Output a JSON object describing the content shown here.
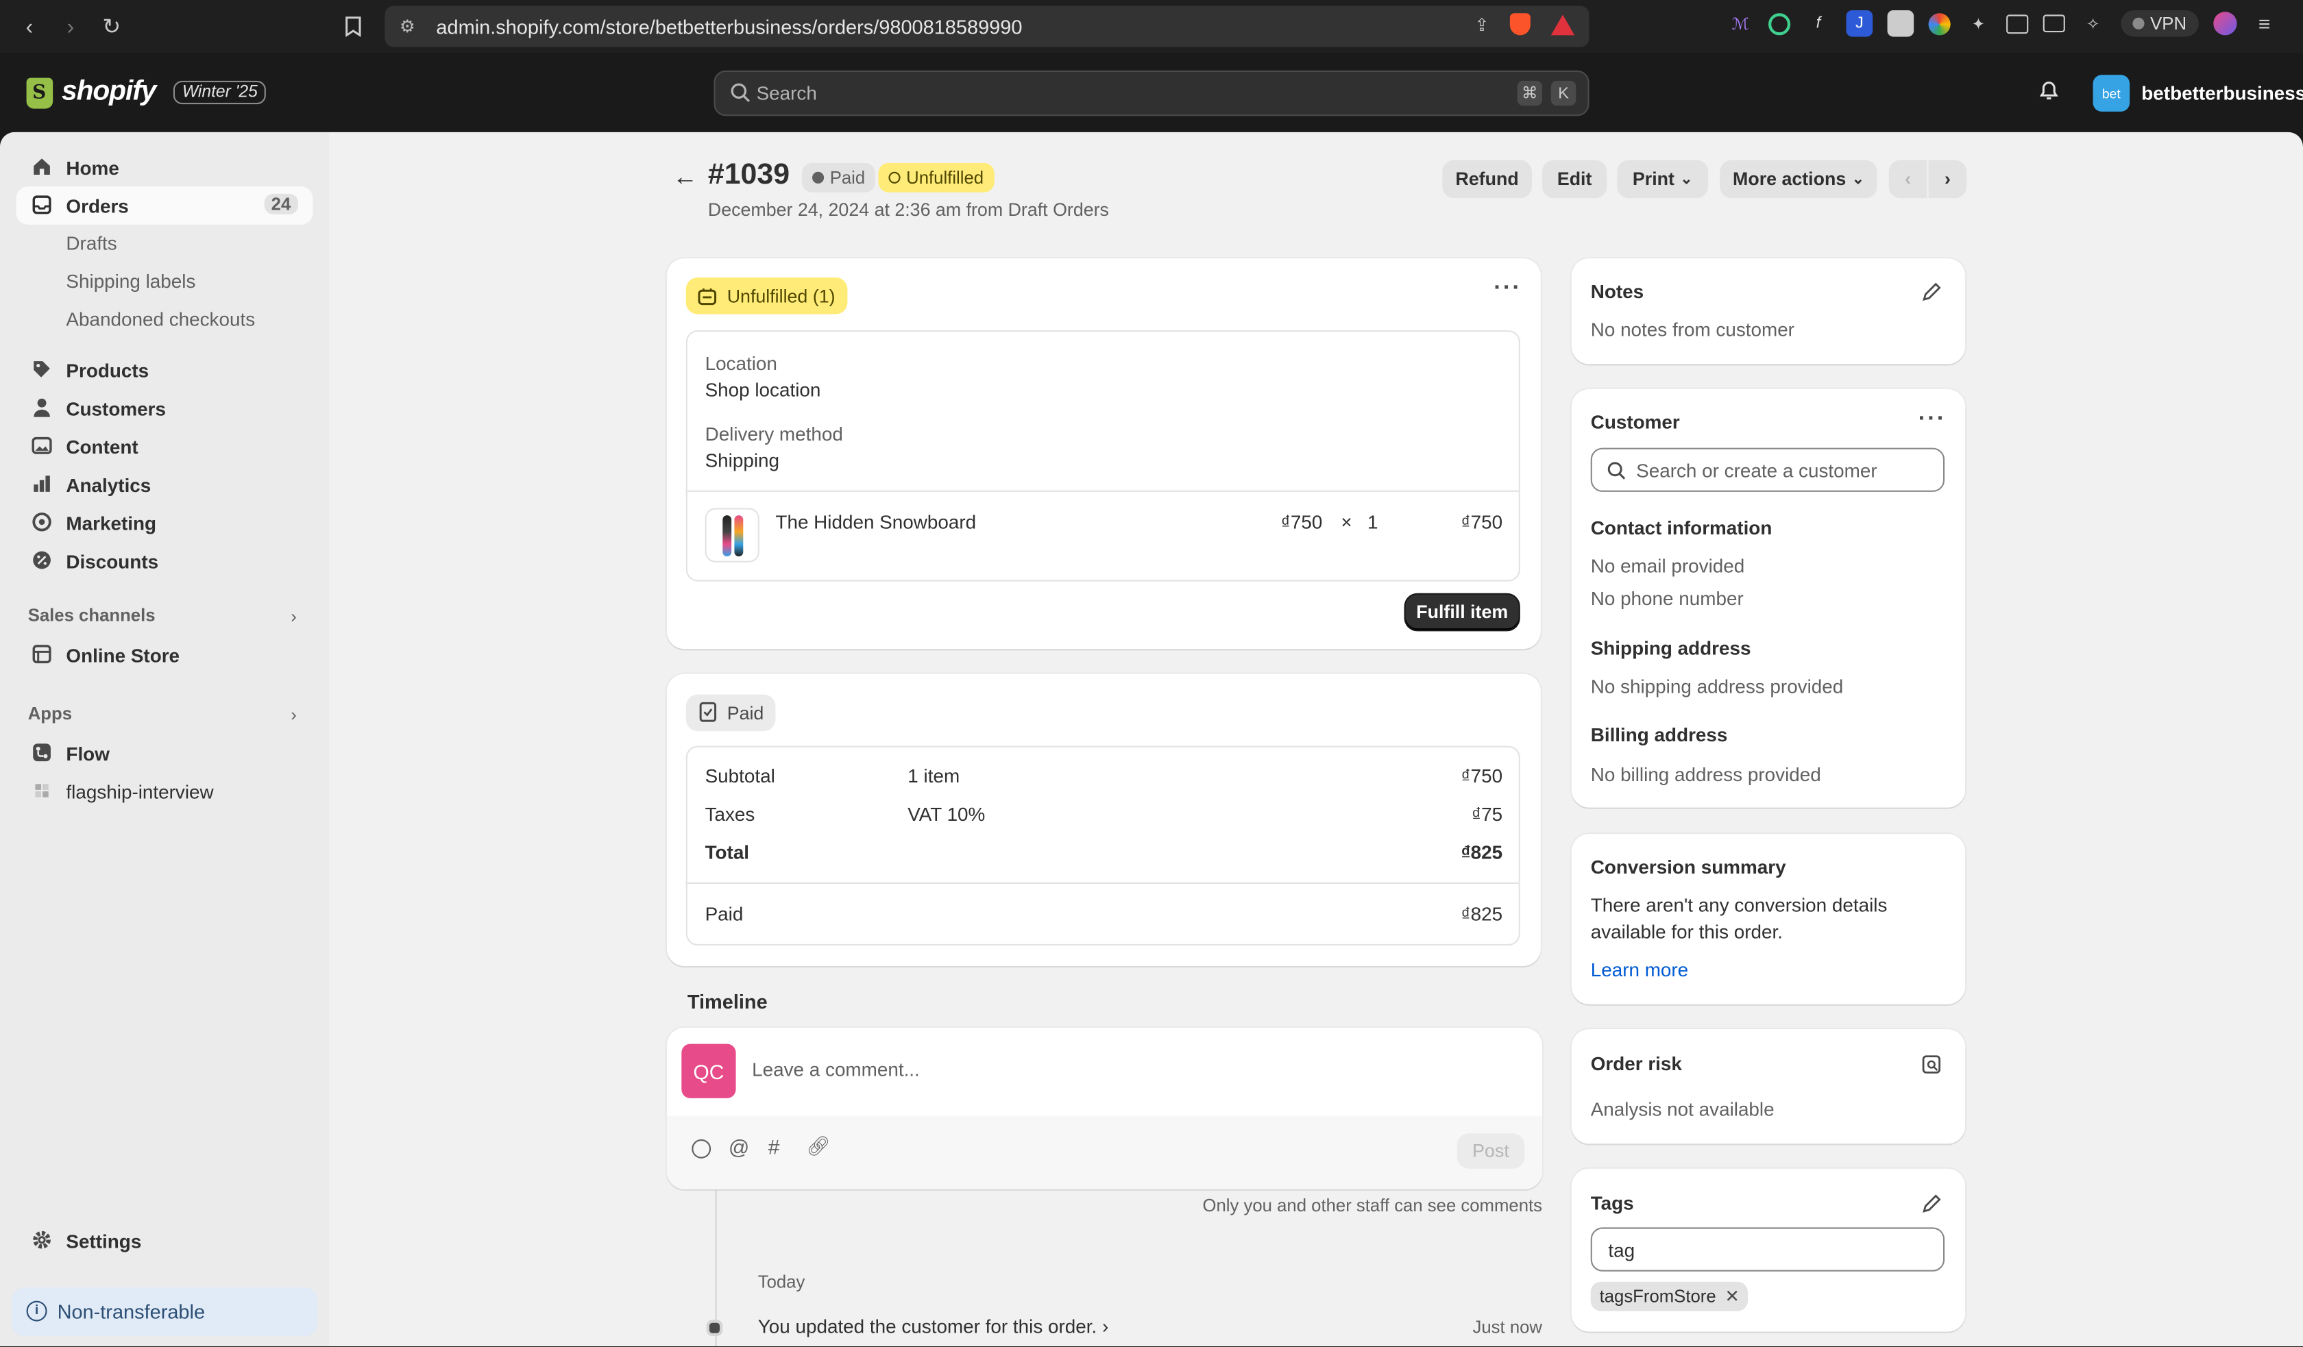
{
  "browser": {
    "url": "admin.shopify.com/store/betbetterbusiness/orders/9800818589990",
    "vpn_label": "VPN"
  },
  "topbar": {
    "logo_text": "shopify",
    "version": "Winter '25",
    "search_placeholder": "Search",
    "search_kbd_1": "⌘",
    "search_kbd_2": "K",
    "store_avatar": "bet",
    "store_name": "betbetterbusiness"
  },
  "sidebar": {
    "home": "Home",
    "orders": "Orders",
    "orders_count": "24",
    "drafts": "Drafts",
    "shipping_labels": "Shipping labels",
    "abandoned_checkouts": "Abandoned checkouts",
    "products": "Products",
    "customers": "Customers",
    "content": "Content",
    "analytics": "Analytics",
    "marketing": "Marketing",
    "discounts": "Discounts",
    "sales_channels": "Sales channels",
    "online_store": "Online Store",
    "apps": "Apps",
    "flow": "Flow",
    "flagship": "flagship-interview",
    "settings": "Settings",
    "non_transferable": "Non-transferable"
  },
  "header": {
    "order_number": "#1039",
    "paid_badge": "Paid",
    "unfulfilled_badge": "Unfulfilled",
    "subtitle": "December 24, 2024 at 2:36 am from Draft Orders",
    "refund": "Refund",
    "edit": "Edit",
    "print": "Print",
    "more_actions": "More actions"
  },
  "fulfillment": {
    "badge": "Unfulfilled (1)",
    "location_label": "Location",
    "location_value": "Shop location",
    "delivery_label": "Delivery method",
    "delivery_value": "Shipping",
    "item_name": "The Hidden Snowboard",
    "item_price": "₫750",
    "item_times": "×",
    "item_qty": "1",
    "item_total": "₫750",
    "fulfill_button": "Fulfill item"
  },
  "payment": {
    "badge": "Paid",
    "subtotal_label": "Subtotal",
    "subtotal_desc": "1 item",
    "subtotal_value": "₫750",
    "taxes_label": "Taxes",
    "taxes_desc": "VAT 10%",
    "taxes_value": "₫75",
    "total_label": "Total",
    "total_value": "₫825",
    "paid_label": "Paid",
    "paid_value": "₫825"
  },
  "timeline": {
    "title": "Timeline",
    "avatar": "QC",
    "comment_placeholder": "Leave a comment...",
    "post": "Post",
    "staff_note": "Only you and other staff can see comments",
    "today": "Today",
    "event": "You updated the customer for this order.",
    "event_time": "Just now"
  },
  "notes": {
    "title": "Notes",
    "text": "No notes from customer"
  },
  "customer": {
    "title": "Customer",
    "search_placeholder": "Search or create a customer",
    "contact_title": "Contact information",
    "no_email": "No email provided",
    "no_phone": "No phone number",
    "shipping_title": "Shipping address",
    "shipping_text": "No shipping address provided",
    "billing_title": "Billing address",
    "billing_text": "No billing address provided"
  },
  "conversion": {
    "title": "Conversion summary",
    "text_1": "There aren't any conversion details",
    "text_2": "available for this order.",
    "learn_more": "Learn more"
  },
  "risk": {
    "title": "Order risk",
    "text": "Analysis not available"
  },
  "tags": {
    "title": "Tags",
    "input_value": "tag",
    "chip": "tagsFromStore"
  },
  "colors": {
    "accent_link": "#005bd3",
    "unfulfilled_badge": "#ffeb78",
    "avatar_pink": "#e74b8a",
    "store_avatar": "#36a3e5"
  }
}
